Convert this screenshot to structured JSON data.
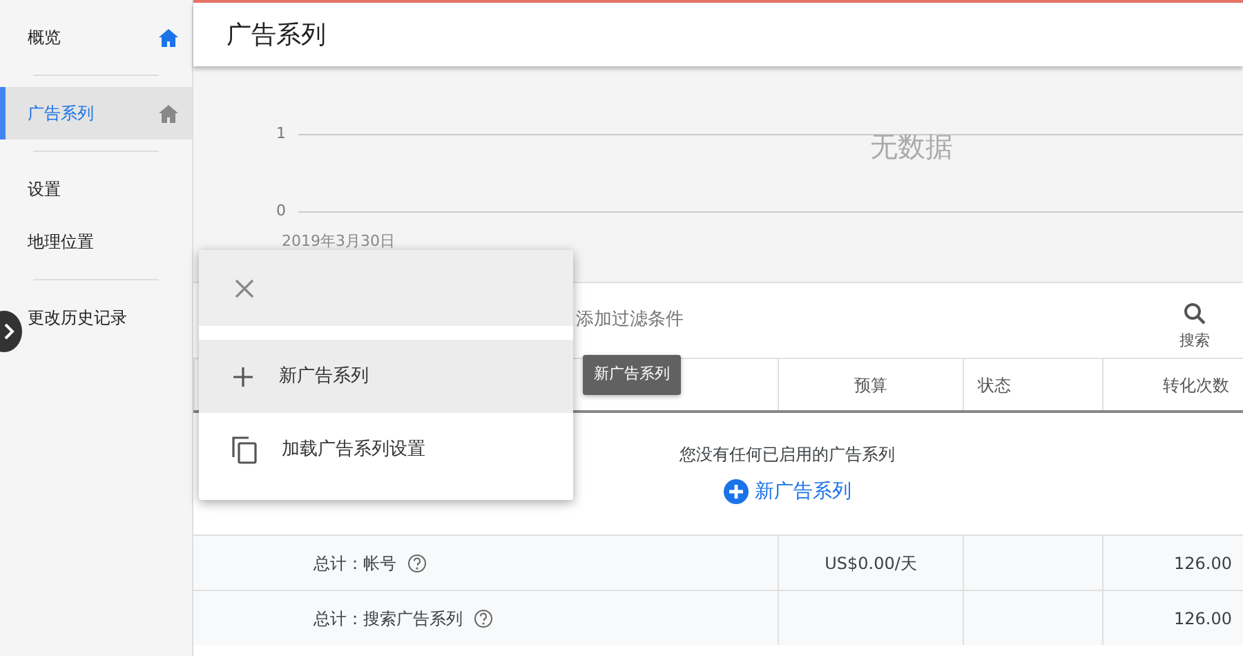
{
  "sidebar": {
    "items": [
      {
        "label": "概览",
        "selected": false,
        "home_icon": true,
        "divider_after": true
      },
      {
        "label": "广告系列",
        "selected": true,
        "home_icon": true,
        "divider_after": true
      },
      {
        "label": "设置",
        "selected": false,
        "home_icon": false,
        "divider_after": false
      },
      {
        "label": "地理位置",
        "selected": false,
        "home_icon": false,
        "divider_after": true
      },
      {
        "label": "更改历史记录",
        "selected": false,
        "home_icon": false,
        "divider_after": false
      }
    ]
  },
  "page_title": "广告系列",
  "chart": {
    "y_ticks": [
      "1",
      "0"
    ],
    "x_label": "2019年3月30日",
    "empty_text": "无数据"
  },
  "filter_bar": {
    "placeholder": "添加过滤条件",
    "search_label": "搜索"
  },
  "table": {
    "columns": [
      "预算",
      "状态",
      "转化次数"
    ],
    "empty_message": "您没有任何已启用的广告系列",
    "empty_action": "新广告系列",
    "rows": [
      {
        "label": "总计：帐号",
        "budget": "US$0.00/天",
        "conversions": "126.00"
      },
      {
        "label": "总计：搜索广告系列",
        "conversions": "126.00"
      }
    ]
  },
  "menu": {
    "items": [
      {
        "kind": "add",
        "label": "新广告系列",
        "selected": true
      },
      {
        "kind": "copy",
        "label": "加载广告系列设置",
        "selected": false
      }
    ]
  },
  "tooltip": "新广告系列"
}
